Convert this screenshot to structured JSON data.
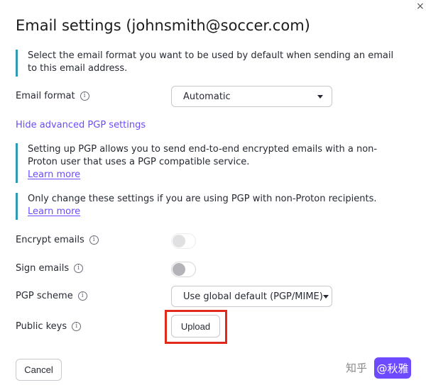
{
  "window": {
    "close_glyph": "×",
    "title": "Email settings (johnsmith@soccer.com)"
  },
  "intro_info": {
    "text": "Select the email format you want to be used by default when sending an email to this email address."
  },
  "email_format": {
    "label": "Email format",
    "value": "Automatic"
  },
  "advanced_link": "Hide advanced PGP settings",
  "pgp_info": {
    "text": "Setting up PGP allows you to send end-to-end encrypted emails with a non-Proton user that uses a PGP compatible service.",
    "learn_more": "Learn more"
  },
  "change_info": {
    "text": "Only change these settings if you are using PGP with non-Proton recipients.",
    "learn_more": "Learn more"
  },
  "encrypt": {
    "label": "Encrypt emails",
    "enabled": false,
    "disabled": true
  },
  "sign": {
    "label": "Sign emails",
    "enabled": false,
    "disabled": false
  },
  "pgp_scheme": {
    "label": "PGP scheme",
    "value": "Use global default (PGP/MIME)"
  },
  "public_keys": {
    "label": "Public keys",
    "upload_label": "Upload"
  },
  "footer": {
    "cancel_label": "Cancel"
  },
  "icons": {
    "info": "info-icon",
    "close": "close-icon",
    "dropdown": "caret-down-icon"
  },
  "colors": {
    "accent": "#6d4aff",
    "info_border": "#2f9bb5",
    "highlight": "#e22a1c"
  },
  "watermark": {
    "site": "知乎",
    "user": "@秋雅"
  }
}
